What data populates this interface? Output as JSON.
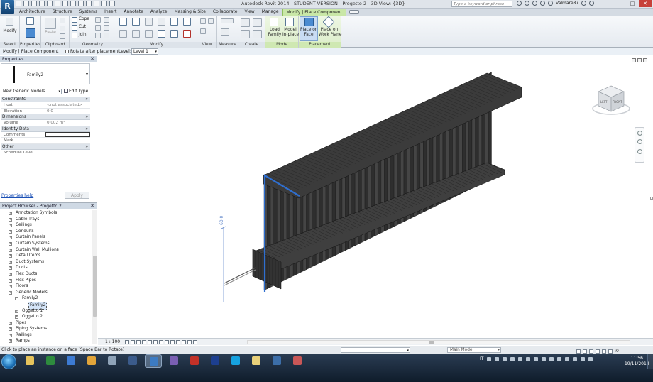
{
  "window": {
    "title": "Autodesk Revit 2014 -  STUDENT VERSION -    Progetto 2 - 3D View: {3D}",
    "search_placeholder": "Type a keyword or phrase",
    "user": "Valmare87",
    "app_letter": "R"
  },
  "ribbon": {
    "tabs": [
      "Architecture",
      "Structure",
      "Systems",
      "Insert",
      "Annotate",
      "Analyze",
      "Massing & Site",
      "Collaborate",
      "View",
      "Manage",
      "Modify | Place Component"
    ],
    "active_tab": "Modify | Place Component",
    "groups": {
      "select": {
        "label": "Select",
        "modify": "Modify"
      },
      "properties": {
        "label": "Properties"
      },
      "clipboard": {
        "label": "Clipboard",
        "paste": "Paste"
      },
      "geometry": {
        "label": "Geometry",
        "cope": "Cope",
        "cut": "Cut",
        "join": "Join"
      },
      "modify": {
        "label": "Modify"
      },
      "view": {
        "label": "View"
      },
      "measure": {
        "label": "Measure"
      },
      "create": {
        "label": "Create"
      },
      "mode": {
        "label": "Mode",
        "load_family": [
          "Load",
          "Family"
        ],
        "model_inplace": [
          "Model",
          "In-place"
        ]
      },
      "placement": {
        "label": "Placement",
        "place_on_face": [
          "Place on",
          "Face"
        ],
        "place_on_workplane": [
          "Place on",
          "Work Plane"
        ]
      }
    }
  },
  "options_bar": {
    "context": "Modify | Place Component",
    "rotate_label": "Rotate after placement",
    "rotate_checked": false,
    "level_label": "Level:",
    "level_value": "Level 1"
  },
  "properties": {
    "title": "Properties",
    "type_name": "Family2",
    "filter": "New Generic Models",
    "edit_type": "Edit Type",
    "sections": [
      {
        "name": "Constraints",
        "rows": [
          {
            "k": "Host",
            "v": "<not associated>"
          },
          {
            "k": "Elevation",
            "v": "0.0"
          }
        ]
      },
      {
        "name": "Dimensions",
        "rows": [
          {
            "k": "Volume",
            "v": "0.002 m³"
          }
        ]
      },
      {
        "name": "Identity Data",
        "rows": [
          {
            "k": "Comments",
            "v": ""
          },
          {
            "k": "Mark",
            "v": ""
          }
        ]
      },
      {
        "name": "Other",
        "rows": [
          {
            "k": "Schedule Level",
            "v": ""
          }
        ]
      }
    ],
    "help_link": "Properties help",
    "apply": "Apply"
  },
  "browser": {
    "title": "Project Browser - Progetto 2",
    "items": [
      {
        "label": "Annotation Symbols",
        "level": 1,
        "exp": "+"
      },
      {
        "label": "Cable Trays",
        "level": 1,
        "exp": "+"
      },
      {
        "label": "Ceilings",
        "level": 1,
        "exp": "+"
      },
      {
        "label": "Conduits",
        "level": 1,
        "exp": "+"
      },
      {
        "label": "Curtain Panels",
        "level": 1,
        "exp": "+"
      },
      {
        "label": "Curtain Systems",
        "level": 1,
        "exp": "+"
      },
      {
        "label": "Curtain Wall Mullions",
        "level": 1,
        "exp": "+"
      },
      {
        "label": "Detail Items",
        "level": 1,
        "exp": "+"
      },
      {
        "label": "Duct Systems",
        "level": 1,
        "exp": "+"
      },
      {
        "label": "Ducts",
        "level": 1,
        "exp": "+"
      },
      {
        "label": "Flex Ducts",
        "level": 1,
        "exp": "+"
      },
      {
        "label": "Flex Pipes",
        "level": 1,
        "exp": "+"
      },
      {
        "label": "Floors",
        "level": 1,
        "exp": "+"
      },
      {
        "label": "Generic Models",
        "level": 1,
        "exp": "-"
      },
      {
        "label": "Family2",
        "level": 2,
        "exp": "-"
      },
      {
        "label": "Family2",
        "level": 3,
        "exp": "",
        "selected": true
      },
      {
        "label": "Oggetto 1",
        "level": 2,
        "exp": "+"
      },
      {
        "label": "Oggetto 2",
        "level": 2,
        "exp": "+"
      },
      {
        "label": "Pipes",
        "level": 1,
        "exp": "+"
      },
      {
        "label": "Piping Systems",
        "level": 1,
        "exp": "+"
      },
      {
        "label": "Railings",
        "level": 1,
        "exp": "+"
      },
      {
        "label": "Ramps",
        "level": 1,
        "exp": "+"
      }
    ]
  },
  "viewport": {
    "viewcube_front": "FRONT",
    "viewcube_left": "LEFT",
    "temp_dimension": "60.0",
    "selected_color": "#2f6fd0",
    "model_color": "#3a3a3a"
  },
  "view_control": {
    "scale": "1 : 100"
  },
  "status_bar": {
    "text": "Click to place an instance on a face (Space Bar to Rotate)",
    "model": "Main Model",
    "filter_count": ":0"
  },
  "taskbar": {
    "language": "IT",
    "time": "11:56",
    "date": "19/11/2014",
    "apps": [
      {
        "name": "explorer",
        "color": "#e6c35c"
      },
      {
        "name": "excel",
        "color": "#2e8b3e"
      },
      {
        "name": "media-player",
        "color": "#3d7bd3"
      },
      {
        "name": "chrome",
        "color": "#e2a53a"
      },
      {
        "name": "bird-app",
        "color": "#8fa3b8"
      },
      {
        "name": "steam",
        "color": "#3b5b8b"
      },
      {
        "name": "revit",
        "color": "#3c7bc3",
        "active": true
      },
      {
        "name": "maxon",
        "color": "#7a5fb3"
      },
      {
        "name": "acrobat",
        "color": "#c23128"
      },
      {
        "name": "photoshop",
        "color": "#1d3f8f"
      },
      {
        "name": "skype",
        "color": "#16a2e0"
      },
      {
        "name": "notes",
        "color": "#e8d07a"
      },
      {
        "name": "windows-media-center",
        "color": "#3c6ea8"
      },
      {
        "name": "tool",
        "color": "#c95757"
      }
    ]
  }
}
